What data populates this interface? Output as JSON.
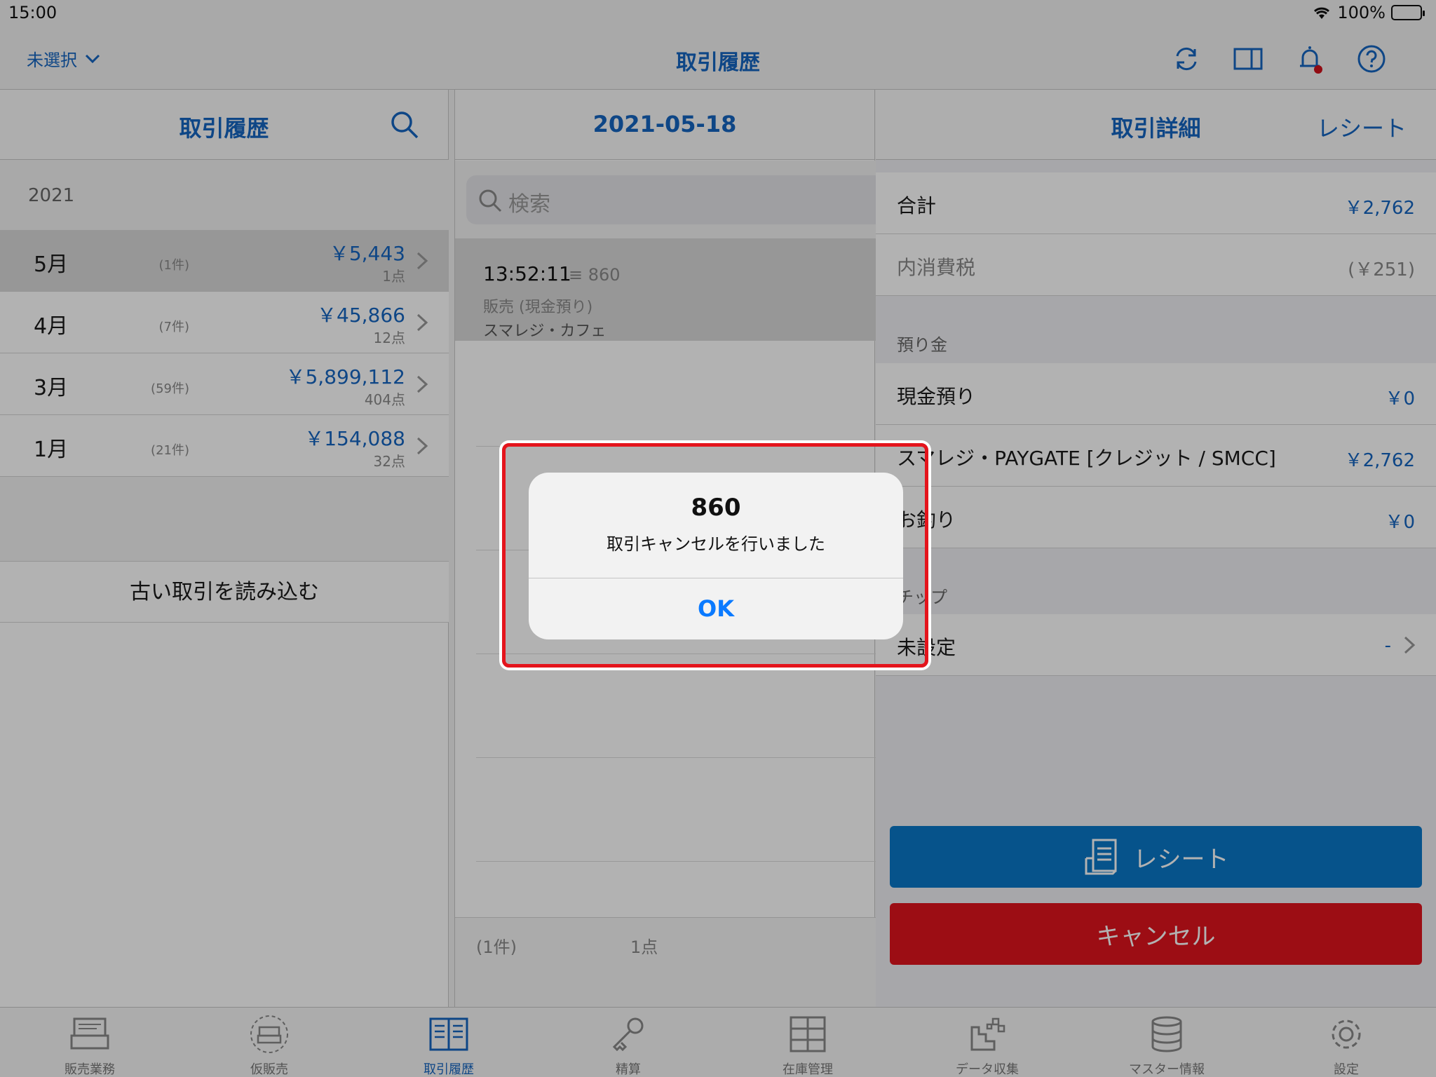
{
  "status": {
    "time": "15:00",
    "battery": "100%"
  },
  "nav": {
    "selector_label": "未選択",
    "title": "取引履歴"
  },
  "left": {
    "header": "取引履歴",
    "year": "2021",
    "months": [
      {
        "month": "5月",
        "count": "(1件)",
        "amount": "￥5,443",
        "points": "1点",
        "selected": true
      },
      {
        "month": "4月",
        "count": "(7件)",
        "amount": "￥45,866",
        "points": "12点",
        "selected": false
      },
      {
        "month": "3月",
        "count": "(59件)",
        "amount": "￥5,899,112",
        "points": "404点",
        "selected": false
      },
      {
        "month": "1月",
        "count": "(21件)",
        "amount": "￥154,088",
        "points": "32点",
        "selected": false
      }
    ],
    "load_older": "古い取引を読み込む"
  },
  "middle": {
    "header": "2021-05-18",
    "search_placeholder": "検索",
    "transaction": {
      "time": "13:52:11",
      "number": "≡ 860",
      "type": "販売 (現金預り)",
      "store": "スマレジ・カフェ"
    },
    "footer_count": "(1件)",
    "footer_points": "1点"
  },
  "right": {
    "header": "取引詳細",
    "header_link": "レシート",
    "total_label": "合計",
    "total_value": "￥2,762",
    "tax_label": "内消費税",
    "tax_value": "(￥251)",
    "deposit_section": "預り金",
    "cash_label": "現金預り",
    "cash_value": "￥0",
    "card_label": "スマレジ・PAYGATE [クレジット / SMCC]",
    "card_value": "￥2,762",
    "change_label": "お釣り",
    "change_value": "￥0",
    "tip_section": "チップ",
    "tip_label": "未設定",
    "tip_value": "-",
    "receipt_button": "レシート",
    "cancel_button": "キャンセル"
  },
  "tabs": [
    {
      "label": "販売業務",
      "icon": "register-icon"
    },
    {
      "label": "仮販売",
      "icon": "temp-register-icon"
    },
    {
      "label": "取引履歴",
      "icon": "history-book-icon",
      "active": true
    },
    {
      "label": "精算",
      "icon": "key-icon"
    },
    {
      "label": "在庫管理",
      "icon": "cabinet-icon"
    },
    {
      "label": "データ収集",
      "icon": "data-collect-icon"
    },
    {
      "label": "マスター情報",
      "icon": "database-icon"
    },
    {
      "label": "設定",
      "icon": "gear-icon"
    }
  ],
  "alert": {
    "title": "860",
    "message": "取引キャンセルを行いました",
    "ok": "OK"
  },
  "colors": {
    "accent": "#1565c0",
    "cancel": "#e0141e",
    "receipt": "#0a78c8",
    "highlight": "#e4141c"
  }
}
